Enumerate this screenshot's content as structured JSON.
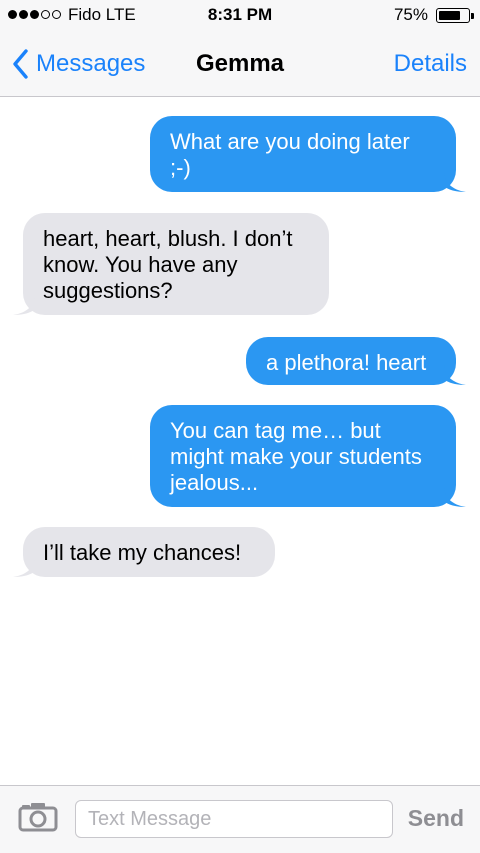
{
  "status_bar": {
    "carrier": "Fido  LTE",
    "time": "8:31 PM",
    "battery_percent": "75%",
    "signal_bars_filled": 3,
    "signal_bars_total": 5,
    "battery_level": 0.75
  },
  "nav": {
    "back_label": "Messages",
    "title": "Gemma",
    "details_label": "Details"
  },
  "messages": [
    {
      "direction": "outgoing",
      "text": "What are you doing later ;-)"
    },
    {
      "direction": "incoming",
      "text": "heart, heart, blush. I don’t know. You have any suggestions?"
    },
    {
      "direction": "outgoing",
      "text": "a plethora! heart"
    },
    {
      "direction": "outgoing",
      "text": "You can tag me… but might make your students jealous..."
    },
    {
      "direction": "incoming",
      "text": "I’ll take my chances!"
    }
  ],
  "input": {
    "placeholder": "Text Message",
    "value": "",
    "send_label": "Send"
  },
  "colors": {
    "accent": "#1a82fb",
    "outgoing_bubble": "#2b97f2",
    "incoming_bubble": "#e5e5ea",
    "send_disabled": "#8e8e93"
  },
  "icons": {
    "back": "chevron-left-icon",
    "camera": "camera-icon"
  }
}
